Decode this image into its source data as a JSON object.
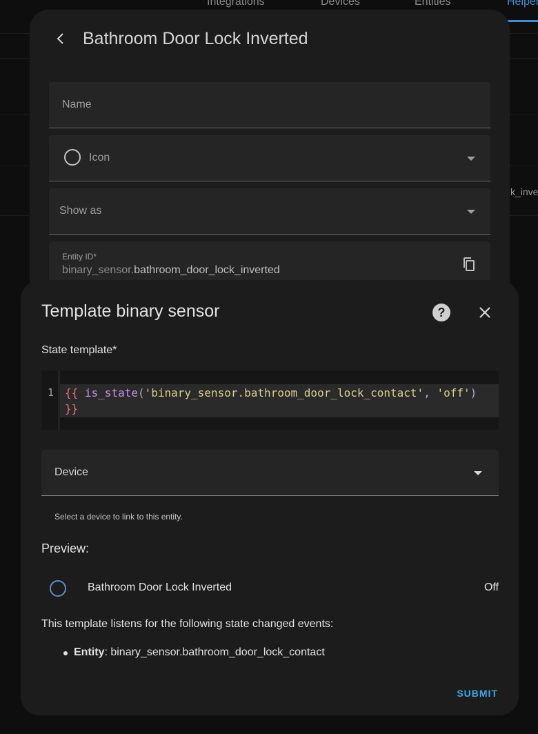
{
  "background": {
    "tabs": [
      "Integrations",
      "Devices",
      "Entities",
      "Helpers"
    ],
    "peek_text": "k_inver"
  },
  "entity_dialog": {
    "title": "Bathroom Door Lock Inverted",
    "name_label": "Name",
    "icon_label": "Icon",
    "show_as_label": "Show as",
    "entity_id_label": "Entity ID*",
    "entity_id_prefix": "binary_sensor.",
    "entity_id_value": "bathroom_door_lock_inverted"
  },
  "template_dialog": {
    "title": "Template binary sensor",
    "help_glyph": "?",
    "state_template_label": "State template*",
    "code_line_number": "1",
    "code": {
      "open": "{{ ",
      "fn": "is_state",
      "paren_open": "(",
      "arg1": "'binary_sensor.bathroom_door_lock_contact'",
      "comma": ", ",
      "arg2": "'off'",
      "paren_close": ")",
      "close": " }}"
    },
    "device_label": "Device",
    "device_helper": "Select a device to link to this entity.",
    "preview_label": "Preview:",
    "preview_entity_name": "Bathroom Door Lock Inverted",
    "preview_state": "Off",
    "listens_text": "This template listens for the following state changed events:",
    "listen_item_label": "Entity",
    "listen_item_sep": ": ",
    "listen_item_value": "binary_sensor.bathroom_door_lock_contact",
    "submit_label": "SUBMIT"
  },
  "icons": {
    "back": "arrow-left-icon",
    "copy": "content-copy-icon",
    "help": "help-circle-icon",
    "close": "close-icon"
  },
  "colors": {
    "accent": "#3ea6e8",
    "dialog_bg": "#1c1c1c",
    "field_bg": "#252525"
  }
}
